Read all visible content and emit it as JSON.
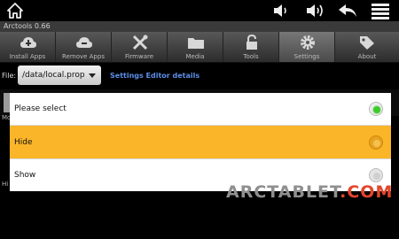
{
  "statusbar": {
    "icons": [
      "home-icon",
      "volume-down-icon",
      "volume-up-icon",
      "back-icon",
      "menu-icon"
    ]
  },
  "window": {
    "title": "Arctools 0.66"
  },
  "tabs": [
    {
      "label": "Install Apps",
      "icon": "cloud-upload-icon",
      "active": false
    },
    {
      "label": "Remove Apps",
      "icon": "cloud-download-icon",
      "active": false
    },
    {
      "label": "Firmware",
      "icon": "tools-icon",
      "active": false
    },
    {
      "label": "Media",
      "icon": "folder-icon",
      "active": false
    },
    {
      "label": "Tools",
      "icon": "unlock-icon",
      "active": false
    },
    {
      "label": "Settings",
      "icon": "gear-icon",
      "active": true
    },
    {
      "label": "About",
      "icon": "tag-icon",
      "active": false
    }
  ],
  "filebar": {
    "label": "File:",
    "selected_file": "/data/local.prop",
    "details_link": "Settings Editor details"
  },
  "background": {
    "left_fragment": "Mo",
    "lower_fragment": "Hi"
  },
  "dialog": {
    "options": [
      {
        "label": "Please select",
        "checked": true,
        "highlighted": false
      },
      {
        "label": "Hide",
        "checked": false,
        "highlighted": true
      },
      {
        "label": "Show",
        "checked": false,
        "highlighted": false
      }
    ]
  },
  "watermark": {
    "part1": "ARCTABLET",
    "part2": ".COM"
  },
  "colors": {
    "accent_orange": "#fbb529",
    "radio_green": "#3ec92f",
    "link_blue": "#5c8ee6",
    "watermark_red": "#e3452d"
  }
}
